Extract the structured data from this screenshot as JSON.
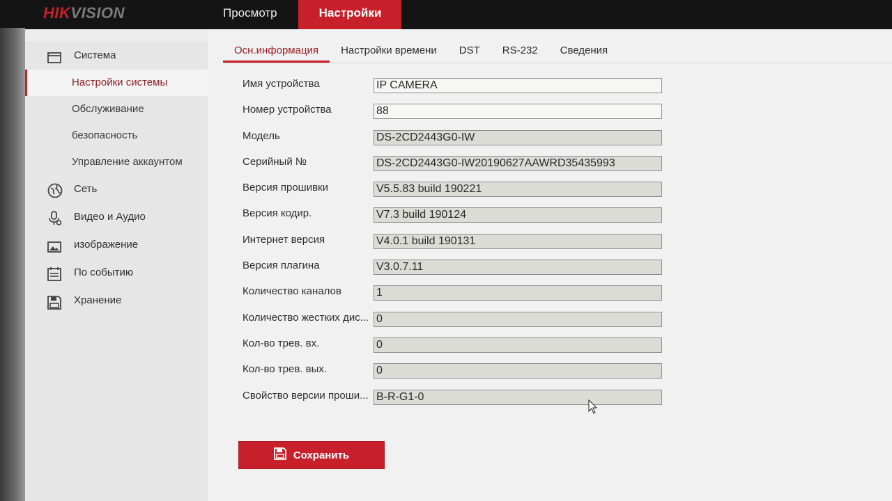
{
  "brand": {
    "logo_hik": "HIK",
    "logo_vision": "VISION"
  },
  "topnav": {
    "items": [
      {
        "label": "Просмотр"
      },
      {
        "label": "Настройки"
      }
    ]
  },
  "sidebar": {
    "sistema": "Система",
    "sub": [
      {
        "label": "Настройки системы"
      },
      {
        "label": "Обслуживание"
      },
      {
        "label": "безопасность"
      },
      {
        "label": "Управление аккаунтом"
      }
    ],
    "main": [
      {
        "label": "Сеть",
        "icon": "globe-icon"
      },
      {
        "label": "Видео и Аудио",
        "icon": "microphone-icon"
      },
      {
        "label": "изображение",
        "icon": "image-icon"
      },
      {
        "label": "По событию",
        "icon": "calendar-icon"
      },
      {
        "label": "Хранение",
        "icon": "save-icon"
      }
    ]
  },
  "tabs": [
    {
      "label": "Осн.информация"
    },
    {
      "label": "Настройки времени"
    },
    {
      "label": "DST"
    },
    {
      "label": "RS-232"
    },
    {
      "label": "Сведения"
    }
  ],
  "form": {
    "fields": [
      {
        "label": "Имя устройства",
        "value": "IP CAMERA"
      },
      {
        "label": "Номер устройства",
        "value": "88"
      },
      {
        "label": "Модель",
        "value": "DS-2CD2443G0-IW"
      },
      {
        "label": "Серийный №",
        "value": "DS-2CD2443G0-IW20190627AAWRD35435993"
      },
      {
        "label": "Версия прошивки",
        "value": "V5.5.83 build 190221"
      },
      {
        "label": "Версия кодир.",
        "value": "V7.3 build 190124"
      },
      {
        "label": "Интернет версия",
        "value": "V4.0.1 build 190131"
      },
      {
        "label": "Версия плагина",
        "value": "V3.0.7.11"
      },
      {
        "label": "Количество каналов",
        "value": "1"
      },
      {
        "label": "Количество жестких дис...",
        "value": "0"
      },
      {
        "label": "Кол-во трев. вх.",
        "value": "0"
      },
      {
        "label": "Кол-во трев. вых.",
        "value": "0"
      },
      {
        "label": "Свойство версии проши...",
        "value": "B-R-G1-0"
      }
    ]
  },
  "save_button": {
    "label": "Сохранить",
    "icon": "floppy-icon"
  },
  "colors": {
    "accent": "#c8202a",
    "topbar": "#141414"
  }
}
